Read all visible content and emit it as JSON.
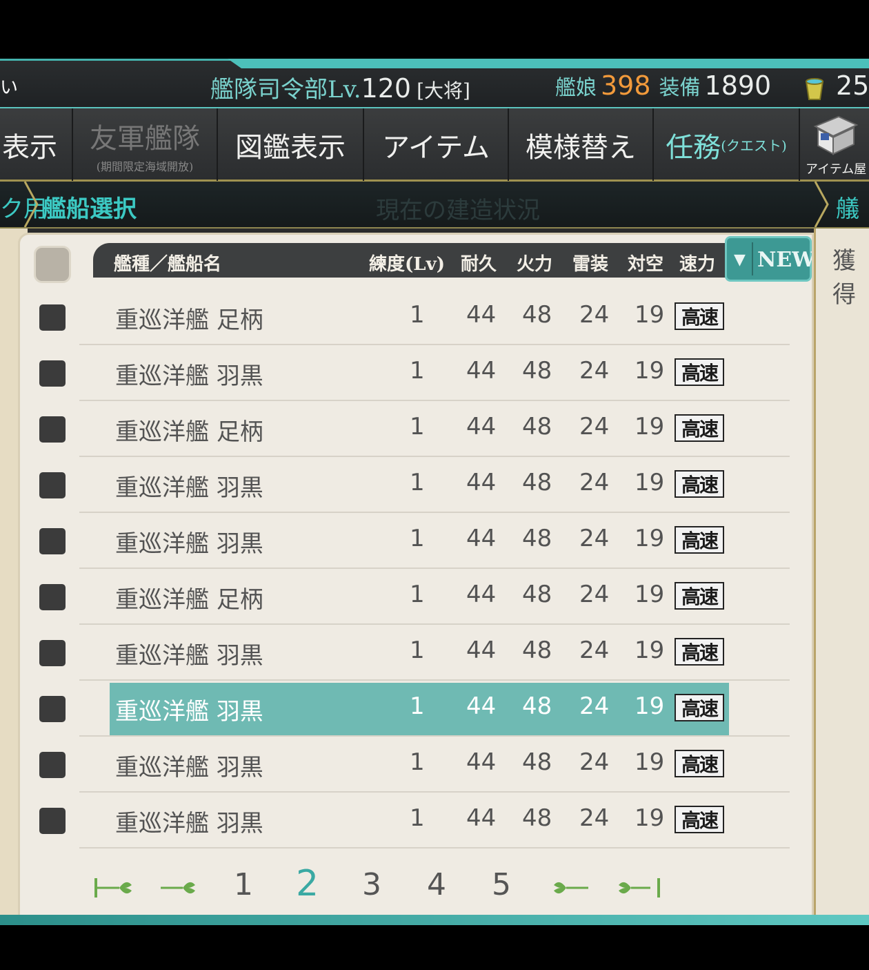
{
  "topbar": {
    "left_cut": "い",
    "hq_label": "艦隊司令部",
    "lv_label": "Lv.",
    "level": "120",
    "rank": "[大将]",
    "ships_label": "艦娘",
    "ships_count": "398",
    "equip_label": "装備",
    "equip_count": "1890",
    "bucket_count": "25"
  },
  "menu": {
    "items": [
      {
        "label": "表示"
      },
      {
        "label": "友軍艦隊",
        "sub": "(期間限定海域開放)"
      },
      {
        "label": "図鑑表示"
      },
      {
        "label": "アイテム"
      },
      {
        "label": "模様替え"
      },
      {
        "label": "任務",
        "small": "(クエスト)"
      }
    ],
    "shop_label": "アイテム屋"
  },
  "breadcrumb": {
    "left": "ク用",
    "title": "艦船選択",
    "ghost": "現在の建造状況",
    "right": "艤装"
  },
  "side_right_label": "獲得",
  "table": {
    "headers": {
      "name": "艦種／艦船名",
      "lv": "練度(Lv)",
      "hp": "耐久",
      "fp": "火力",
      "torp": "雷装",
      "aa": "対空",
      "speed": "速力"
    },
    "sort_button": "NEW",
    "rows": [
      {
        "type": "重巡洋艦",
        "name": "足柄",
        "lv": "1",
        "hp": "44",
        "fp": "48",
        "torp": "24",
        "aa": "19",
        "speed": "高速"
      },
      {
        "type": "重巡洋艦",
        "name": "羽黒",
        "lv": "1",
        "hp": "44",
        "fp": "48",
        "torp": "24",
        "aa": "19",
        "speed": "高速"
      },
      {
        "type": "重巡洋艦",
        "name": "足柄",
        "lv": "1",
        "hp": "44",
        "fp": "48",
        "torp": "24",
        "aa": "19",
        "speed": "高速"
      },
      {
        "type": "重巡洋艦",
        "name": "羽黒",
        "lv": "1",
        "hp": "44",
        "fp": "48",
        "torp": "24",
        "aa": "19",
        "speed": "高速"
      },
      {
        "type": "重巡洋艦",
        "name": "羽黒",
        "lv": "1",
        "hp": "44",
        "fp": "48",
        "torp": "24",
        "aa": "19",
        "speed": "高速"
      },
      {
        "type": "重巡洋艦",
        "name": "足柄",
        "lv": "1",
        "hp": "44",
        "fp": "48",
        "torp": "24",
        "aa": "19",
        "speed": "高速"
      },
      {
        "type": "重巡洋艦",
        "name": "羽黒",
        "lv": "1",
        "hp": "44",
        "fp": "48",
        "torp": "24",
        "aa": "19",
        "speed": "高速"
      },
      {
        "type": "重巡洋艦",
        "name": "羽黒",
        "lv": "1",
        "hp": "44",
        "fp": "48",
        "torp": "24",
        "aa": "19",
        "speed": "高速",
        "selected": true
      },
      {
        "type": "重巡洋艦",
        "name": "羽黒",
        "lv": "1",
        "hp": "44",
        "fp": "48",
        "torp": "24",
        "aa": "19",
        "speed": "高速"
      },
      {
        "type": "重巡洋艦",
        "name": "羽黒",
        "lv": "1",
        "hp": "44",
        "fp": "48",
        "torp": "24",
        "aa": "19",
        "speed": "高速"
      }
    ]
  },
  "pager": {
    "pages": [
      "1",
      "2",
      "3",
      "4",
      "5"
    ],
    "current": "2",
    "icons": [
      "first-page-icon",
      "prev-page-icon",
      "next-page-icon",
      "last-page-icon"
    ]
  },
  "colors": {
    "accent_teal": "#44b3ae",
    "ship_count_orange": "#f29a3b",
    "selected_row": "#6fbab3"
  }
}
